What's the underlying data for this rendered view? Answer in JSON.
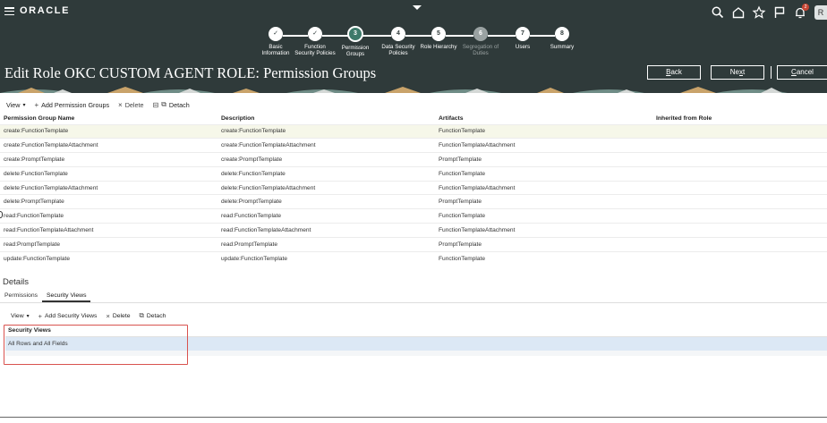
{
  "app": {
    "logo": "ORACLE",
    "avatar": "R",
    "notifications": "2"
  },
  "train": {
    "steps": [
      {
        "line1": "Basic",
        "line2": "Information",
        "symbol": "✓",
        "state": "done"
      },
      {
        "line1": "Function",
        "line2": "Security Policies",
        "symbol": "✓",
        "state": "done"
      },
      {
        "line1": "Permission",
        "line2": "Groups",
        "symbol": "3",
        "state": "current"
      },
      {
        "line1": "Data Security",
        "line2": "Policies",
        "symbol": "4",
        "state": "todo"
      },
      {
        "line1": "Role Hierarchy",
        "line2": "",
        "symbol": "5",
        "state": "todo"
      },
      {
        "line1": "Segregation of",
        "line2": "Duties",
        "symbol": "6",
        "state": "disabled"
      },
      {
        "line1": "Users",
        "line2": "",
        "symbol": "7",
        "state": "todo"
      },
      {
        "line1": "Summary",
        "line2": "",
        "symbol": "8",
        "state": "todo"
      }
    ]
  },
  "page": {
    "title": "Edit Role OKC CUSTOM AGENT ROLE: Permission Groups"
  },
  "actions": {
    "back_u": "B",
    "back_rest": "ack",
    "next_pre": "Ne",
    "next_u": "x",
    "next_post": "t",
    "cancel_u": "C",
    "cancel_rest": "ancel"
  },
  "toolbar": {
    "view": "View",
    "add": "Add Permission Groups",
    "delete": "Delete",
    "detach": "Detach"
  },
  "permission_groups": {
    "headers": [
      "Permission Group Name",
      "Description",
      "Artifacts",
      "Inherited from Role"
    ],
    "rows": [
      [
        "create:FunctionTemplate",
        "create:FunctionTemplate",
        "FunctionTemplate",
        ""
      ],
      [
        "create:FunctionTemplateAttachment",
        "create:FunctionTemplateAttachment",
        "FunctionTemplateAttachment",
        ""
      ],
      [
        "create:PromptTemplate",
        "create:PromptTemplate",
        "PromptTemplate",
        ""
      ],
      [
        "delete:FunctionTemplate",
        "delete:FunctionTemplate",
        "FunctionTemplate",
        ""
      ],
      [
        "delete:FunctionTemplateAttachment",
        "delete:FunctionTemplateAttachment",
        "FunctionTemplateAttachment",
        ""
      ],
      [
        "delete:PromptTemplate",
        "delete:PromptTemplate",
        "PromptTemplate",
        ""
      ],
      [
        "read:FunctionTemplate",
        "read:FunctionTemplate",
        "FunctionTemplate",
        ""
      ],
      [
        "read:FunctionTemplateAttachment",
        "read:FunctionTemplateAttachment",
        "FunctionTemplateAttachment",
        ""
      ],
      [
        "read:PromptTemplate",
        "read:PromptTemplate",
        "PromptTemplate",
        ""
      ],
      [
        "update:FunctionTemplate",
        "update:FunctionTemplate",
        "FunctionTemplate",
        ""
      ]
    ]
  },
  "details": {
    "title": "Details",
    "tabs": [
      "Permissions",
      "Security Views"
    ],
    "active_tab": "Security Views",
    "toolbar": {
      "view": "View",
      "add": "Add Security Views",
      "delete": "Delete",
      "detach": "Detach"
    },
    "header": "Security Views",
    "rows": [
      "All Rows and All Fields"
    ]
  },
  "colors": {
    "header_bg": "#2f3a3a",
    "current_step": "#3e7a6a",
    "selected_row": "#f6f7e9",
    "security_row": "#dce8f5",
    "highlight_border": "#d9534f"
  }
}
